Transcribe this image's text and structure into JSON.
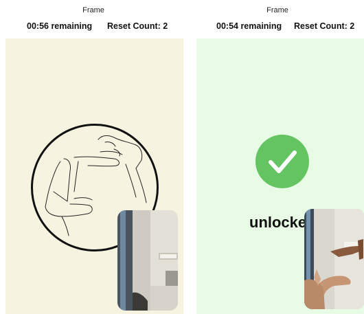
{
  "left_screen": {
    "title": "Frame",
    "timer": "00:56 remaining",
    "reset_count": "Reset Count: 2",
    "background_color": "#f7f3e1",
    "gesture_icon": "hand-frame-gesture-icon",
    "camera_preview_icon": "camera-preview"
  },
  "right_screen": {
    "title": "Frame",
    "timer": "00:54 remaining",
    "reset_count": "Reset Count: 2",
    "background_color": "#e8fbe4",
    "status_icon": "checkmark-icon",
    "status_color": "#64c461",
    "status_text": "unlocke",
    "camera_preview_icon": "camera-preview"
  }
}
